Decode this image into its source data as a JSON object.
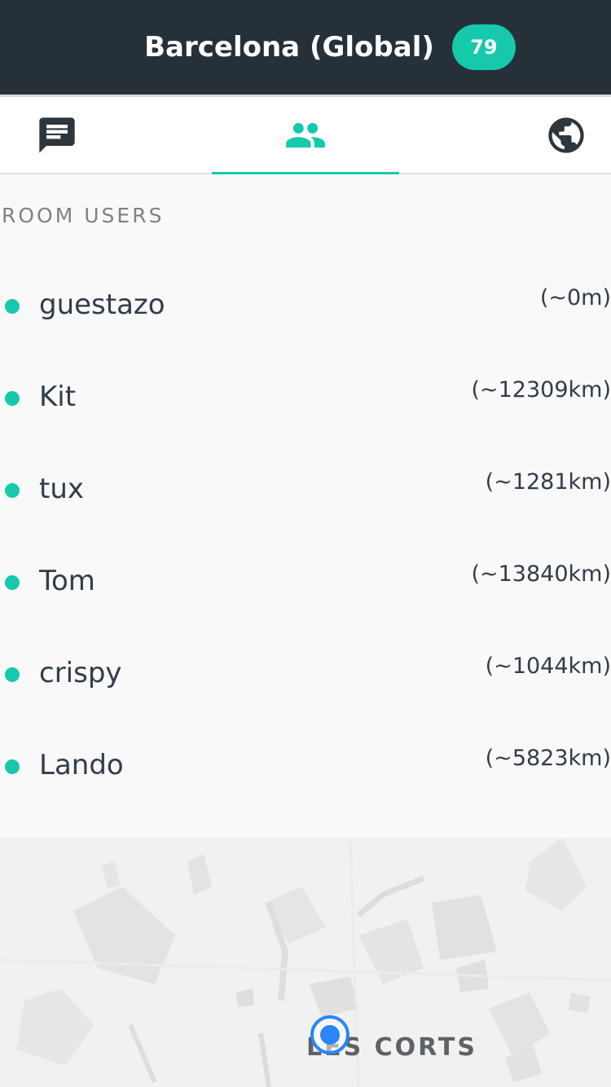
{
  "header": {
    "title": "Barcelona (Global)",
    "badge_count": "79"
  },
  "tabs": [
    {
      "icon": "chat-icon",
      "active": false
    },
    {
      "icon": "users-icon",
      "active": true
    },
    {
      "icon": "globe-icon",
      "active": false
    }
  ],
  "section": {
    "label": "ROOM USERS"
  },
  "users": [
    {
      "name": "guestazo",
      "distance": "(~0m)"
    },
    {
      "name": "Kit",
      "distance": "(~12309km)"
    },
    {
      "name": "tux",
      "distance": "(~1281km)"
    },
    {
      "name": "Tom",
      "distance": "(~13840km)"
    },
    {
      "name": "crispy",
      "distance": "(~1044km)"
    },
    {
      "name": "Lando",
      "distance": "(~5823km)"
    }
  ],
  "map": {
    "label": "LES CORTS"
  },
  "colors": {
    "accent": "#17c9ac",
    "header_bg": "#263039",
    "location_marker": "#2a86f5"
  }
}
